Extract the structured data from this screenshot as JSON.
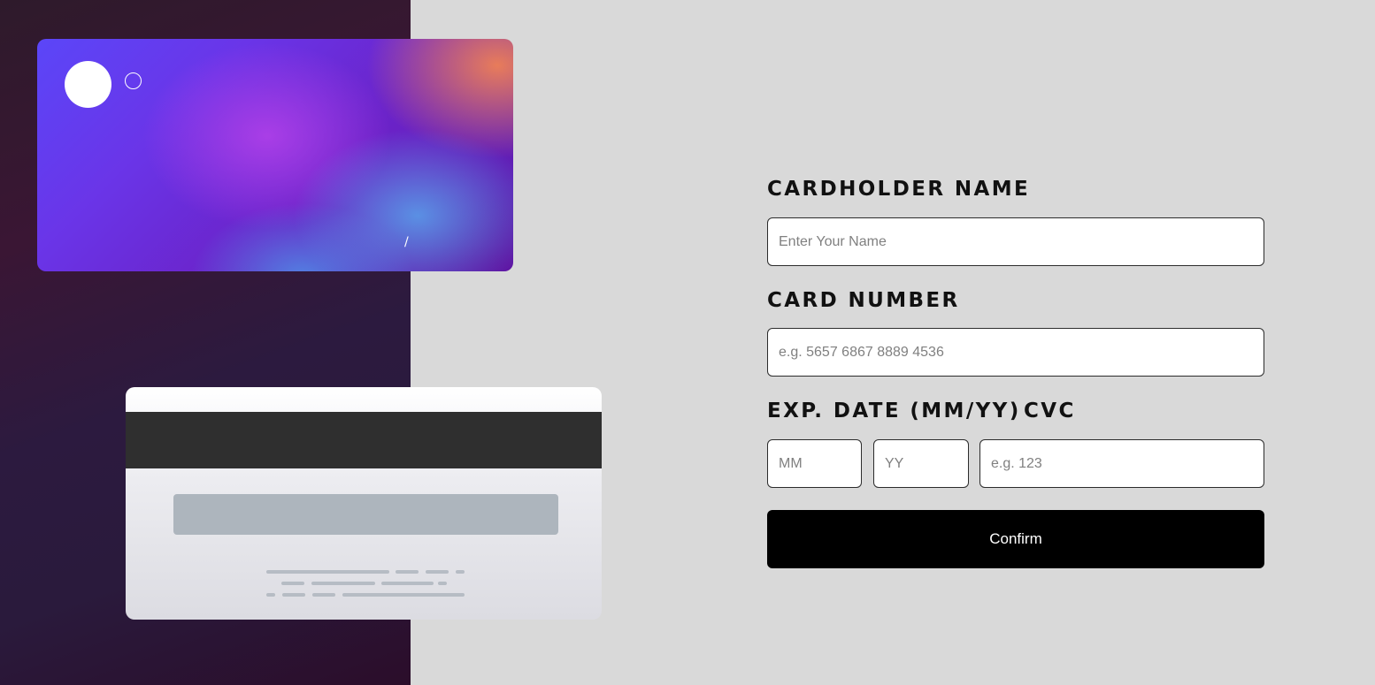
{
  "card_front": {
    "expiry_separator": "/"
  },
  "card_back": {
    "cvc": ""
  },
  "form": {
    "name_label": "CARDHOLDER NAME",
    "name_placeholder": "Enter Your Name",
    "number_label": "CARD NUMBER",
    "number_placeholder": "e.g. 5657 6867 8889 4536",
    "exp_label": "EXP. DATE (MM/YY)",
    "cvc_label": "CVC",
    "mm_placeholder": "MM",
    "yy_placeholder": "YY",
    "cvc_placeholder": "e.g. 123",
    "confirm_label": "Confirm"
  },
  "colors": {
    "page_background": "#d9d9d9",
    "left_panel": "#2c1a3f",
    "button": "#000000",
    "button_text": "#ffffff"
  }
}
